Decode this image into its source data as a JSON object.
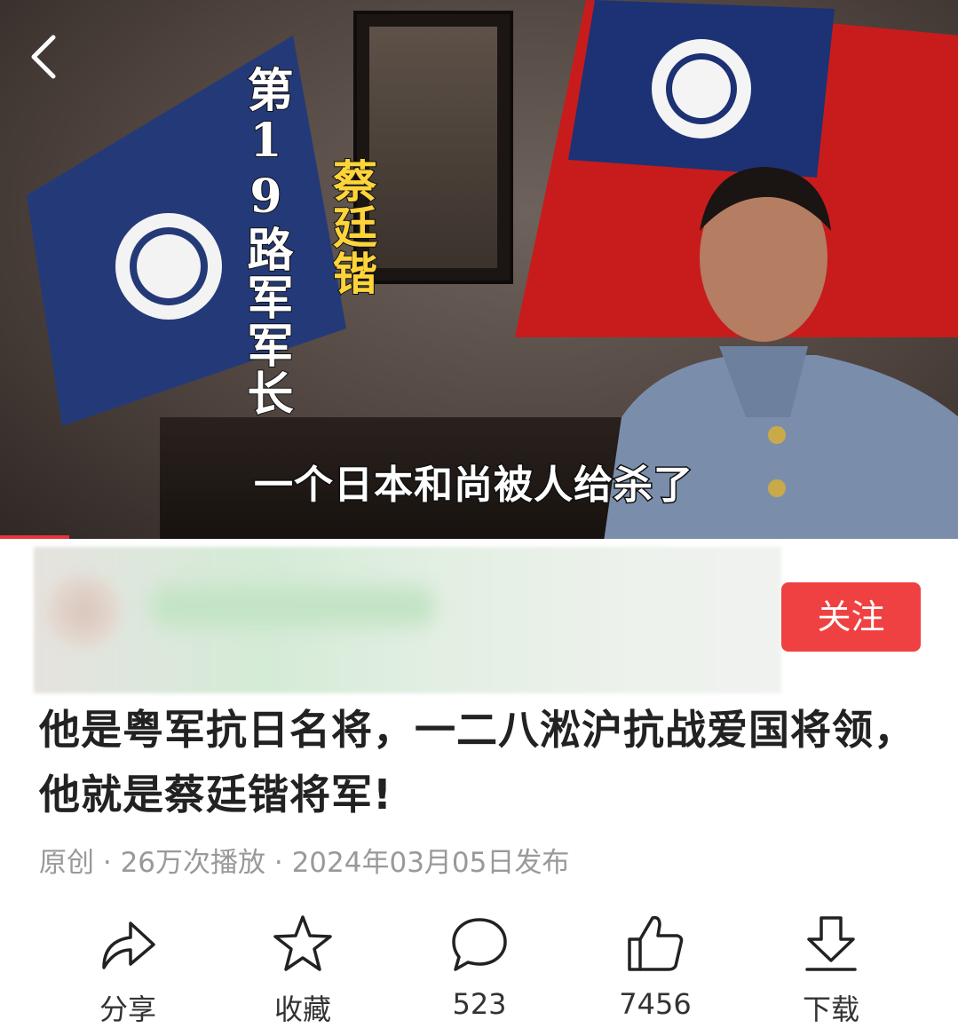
{
  "video": {
    "overlay_title": "第19路军军长",
    "overlay_name": "蔡廷锴",
    "subtitle": "一个日本和尚被人给杀了",
    "progress_fraction": 0.072
  },
  "header": {
    "back_icon": "chevron-left-icon"
  },
  "author": {
    "follow_label": "关注"
  },
  "title": "他是粤军抗日名将，一二八淞沪抗战爱国将领，他就是蔡廷锴将军!",
  "meta": {
    "type": "原创",
    "sep1": " · ",
    "plays": "26万次播放",
    "sep2": " · ",
    "date": "2024年03月05日发布"
  },
  "actions": [
    {
      "icon": "share-icon",
      "label": "分享"
    },
    {
      "icon": "star-icon",
      "label": "收藏"
    },
    {
      "icon": "comment-icon",
      "label": "523"
    },
    {
      "icon": "thumbs-up-icon",
      "label": "7456"
    },
    {
      "icon": "download-icon",
      "label": "下载"
    }
  ],
  "colors": {
    "accent": "#f04142",
    "progress": "#e8343a",
    "overlay_name": "#ffd43a"
  }
}
